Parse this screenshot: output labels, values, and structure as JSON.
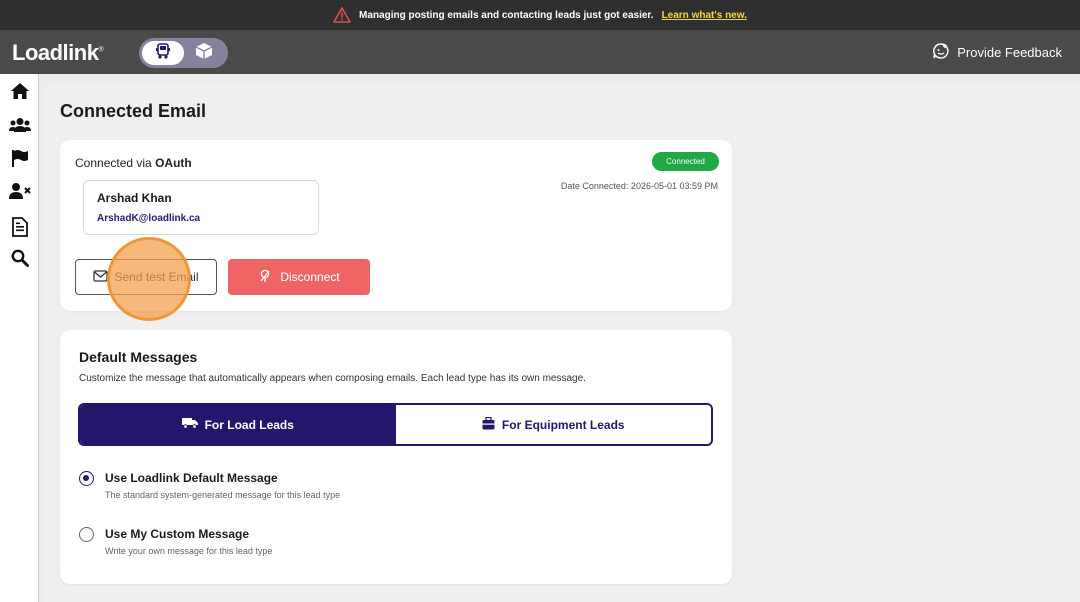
{
  "announcement": {
    "text": "Managing posting emails and contacting leads just got easier.",
    "link": "Learn what's new."
  },
  "header": {
    "logo": "Loadlink",
    "logo_mark": "®",
    "feedback_label": "Provide Feedback"
  },
  "page": {
    "title": "Connected Email"
  },
  "connection": {
    "via_prefix": "Connected via ",
    "via_method": "OAuth",
    "status": "Connected",
    "date_connected": "Date Connected: 2026-05-01 03:59 PM",
    "account_name": "Arshad Khan",
    "account_email": "ArshadK@loadlink.ca",
    "send_test_label": "Send test Email",
    "disconnect_label": "Disconnect"
  },
  "default_messages": {
    "title": "Default Messages",
    "description": "Customize the message that automatically appears when composing emails. Each lead type has its own message.",
    "tabs": [
      {
        "label": "For Load Leads",
        "active": true
      },
      {
        "label": "For Equipment Leads",
        "active": false
      }
    ],
    "options": [
      {
        "label": "Use Loadlink Default Message",
        "hint": "The standard system-generated message for this lead type",
        "selected": true
      },
      {
        "label": "Use My Custom Message",
        "hint": "Write your own message for this lead type",
        "selected": false
      }
    ]
  },
  "colors": {
    "brand_purple": "#25166c",
    "connected_green": "#1fa845",
    "disconnect_red": "#ef6565",
    "announcement_link": "#f3d64a"
  },
  "icons": {
    "sidebar": [
      "home-icon",
      "users-icon",
      "flag-icon",
      "user-remove-icon",
      "document-icon",
      "search-icon"
    ]
  }
}
